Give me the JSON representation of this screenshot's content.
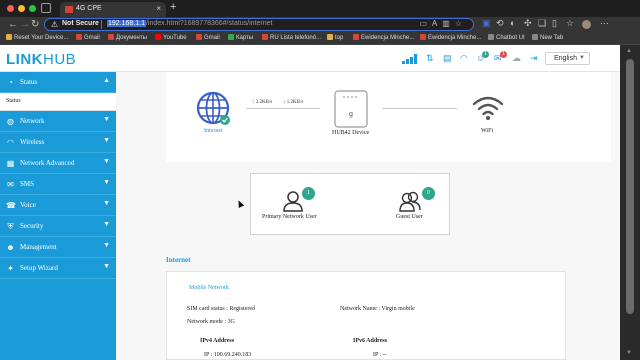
{
  "browser": {
    "tab_title": "4G CPE",
    "new_tab_glyph": "+",
    "security_label": "Not Secure",
    "url_host": "192.168.1.1",
    "url_rest": "/index.html?1689778366#/status/internet",
    "bookmarks": [
      {
        "label": "Reset Your Device...",
        "color": "#e2b13c"
      },
      {
        "label": "Gmail",
        "color": "#d44638"
      },
      {
        "label": "Документы",
        "color": "#d44638"
      },
      {
        "label": "YouTube",
        "color": "#ff0000"
      },
      {
        "label": "Gmail",
        "color": "#d44638"
      },
      {
        "label": "Карты",
        "color": "#34a853"
      },
      {
        "label": "RU Lista telefonó...",
        "color": "#d44638"
      },
      {
        "label": "top",
        "color": "#e2b13c"
      },
      {
        "label": "Ewidencja Minche...",
        "color": "#d44638"
      },
      {
        "label": "Ewidencja Minche...",
        "color": "#d44638"
      },
      {
        "label": "Chatbot UI",
        "color": "#888888"
      },
      {
        "label": "New Tab",
        "color": "#888888"
      }
    ]
  },
  "header": {
    "logo_part1": "LINK",
    "logo_part2": "HUB",
    "language": "English",
    "notifications": {
      "users_badge": "1",
      "mail_badge": "1"
    },
    "brand_color": "#1a9bd7"
  },
  "sidebar": {
    "items": [
      {
        "label": "Status",
        "icon": "pie-chart-icon"
      },
      {
        "label": "Network",
        "icon": "globe-icon"
      },
      {
        "label": "Wireless",
        "icon": "wifi-icon"
      },
      {
        "label": "Network Advanced",
        "icon": "grid-icon"
      },
      {
        "label": "SMS",
        "icon": "envelope-icon"
      },
      {
        "label": "Voice",
        "icon": "phone-icon"
      },
      {
        "label": "Security",
        "icon": "shield-icon"
      },
      {
        "label": "Management",
        "icon": "people-icon"
      },
      {
        "label": "Setup Wizard",
        "icon": "wand-icon"
      }
    ],
    "active_sub": "Status"
  },
  "topology": {
    "internet_label": "Internet",
    "upload_rate": "3.2KB/s",
    "download_rate": "1.2KB/s",
    "device_label": "HUB42 Device",
    "wifi_label": "WiFi",
    "primary_user_label": "Primary Network User",
    "primary_user_count": "1",
    "guest_user_label": "Guest User",
    "guest_user_count": "0"
  },
  "internet": {
    "section_title": "Internet",
    "card_title": "Mobile Network",
    "sim_status": "SIM card status : Registered",
    "network_name": "Network Name : Virgin mobile",
    "network_mode": "Network mode : 3G",
    "ipv4_title": "IPv4 Address",
    "ipv4_ip": "IP : 100.69.240.183",
    "ipv6_title": "IPv6 Address",
    "ipv6_ip": "IP : --"
  }
}
